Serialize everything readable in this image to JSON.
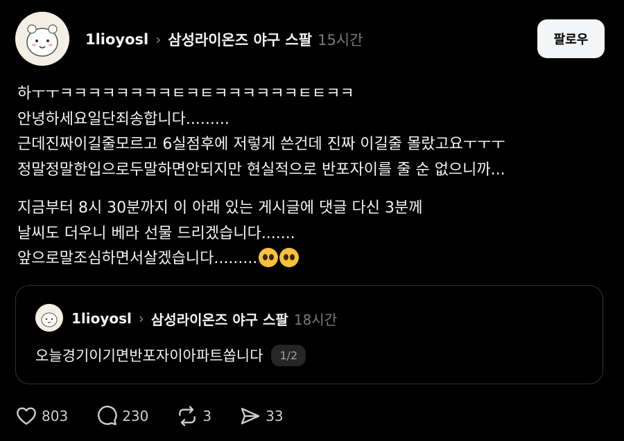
{
  "post": {
    "username": "1lioyosl",
    "community": "삼성라이온즈 야구 스팔",
    "time": "15시간",
    "follow_label": "팔로우",
    "lines": [
      "하ㅜㅜㅋㅋㅋㅋㅋㅋㅋㅋㅌㅋㅌㅋㅋㅋㅋㅋㅋㅌㅌㅋㅋ",
      "안녕하세요일단죄송합니다.........",
      "근데진짜이길줄모르고 6실점후에 저렇게 쓴건데 진짜 이길줄 몰랐고요ㅜㅜㅜ",
      "정말정말한입으로두말하면안되지만 현실적으로 반포자이를 줄 순 없으니까...",
      "지금부터 8시 30분까지 이 아래 있는 게시글에 댓글 다신 3분께",
      "날씨도 더우니 베라 선물 드리겠습니다.......",
      "앞으로말조심하면서살겠습니다........."
    ]
  },
  "quote": {
    "username": "1lioyosl",
    "community": "삼성라이온즈 야구 스팔",
    "time": "18시간",
    "text": "오늘경기이기면반포자이아파트쏩니다",
    "page_indicator": "1/2"
  },
  "actions": {
    "likes": "803",
    "replies": "230",
    "reposts": "3",
    "shares": "33"
  },
  "icons": {
    "like": "heart-icon",
    "reply": "comment-bubble-icon",
    "repost": "repost-icon",
    "share": "send-icon",
    "chevron": "chevron-right-icon",
    "emoji": "pleading-face-emoji"
  },
  "colors": {
    "background": "#000000",
    "text": "#f3f5f7",
    "muted": "#7a7a7a",
    "button_bg": "#f3f5f7",
    "border": "#333333"
  }
}
